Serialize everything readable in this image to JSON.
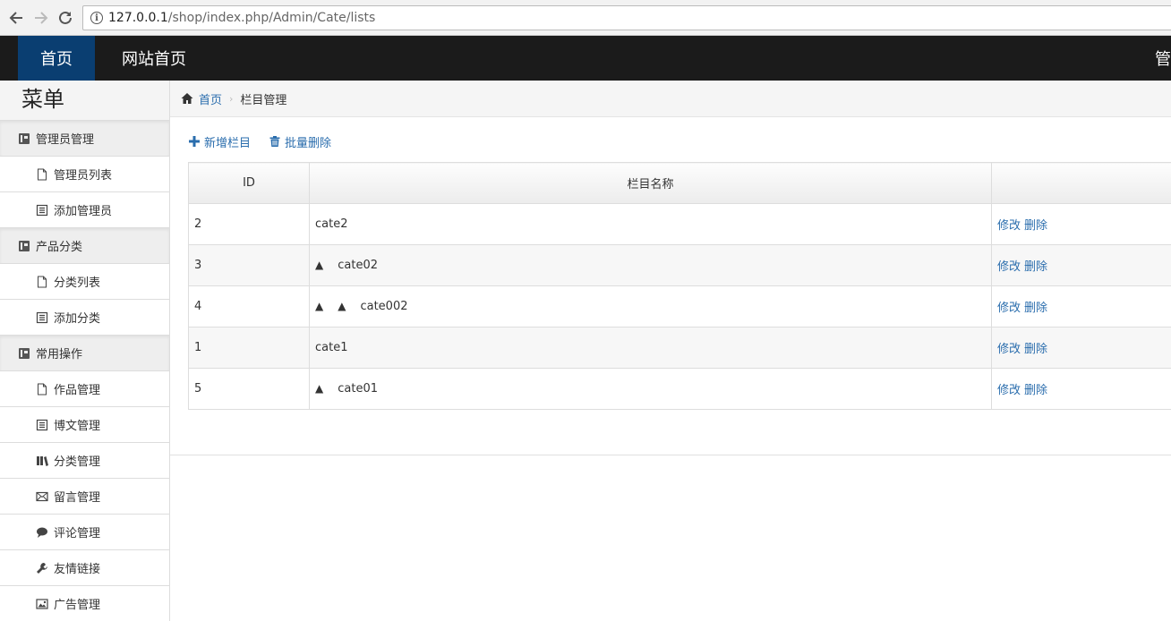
{
  "browser": {
    "url_host": "127.0.0.1",
    "url_path": "/shop/index.php/Admin/Cate/lists"
  },
  "topnav": {
    "home": "首页",
    "site_home": "网站首页",
    "right_partial": "管"
  },
  "sidebar": {
    "title": "菜单",
    "groups": [
      {
        "label": "管理员管理",
        "items": [
          {
            "label": "管理员列表",
            "icon": "file-icon"
          },
          {
            "label": "添加管理员",
            "icon": "list-icon"
          }
        ]
      },
      {
        "label": "产品分类",
        "items": [
          {
            "label": "分类列表",
            "icon": "file-icon"
          },
          {
            "label": "添加分类",
            "icon": "list-icon"
          }
        ]
      },
      {
        "label": "常用操作",
        "items": [
          {
            "label": "作品管理",
            "icon": "file-icon"
          },
          {
            "label": "博文管理",
            "icon": "list-icon"
          },
          {
            "label": "分类管理",
            "icon": "books-icon"
          },
          {
            "label": "留言管理",
            "icon": "envelope-icon"
          },
          {
            "label": "评论管理",
            "icon": "comment-icon"
          },
          {
            "label": "友情链接",
            "icon": "wrench-icon"
          },
          {
            "label": "广告管理",
            "icon": "picture-icon"
          }
        ]
      }
    ]
  },
  "breadcrumb": {
    "home": "首页",
    "current": "栏目管理"
  },
  "toolbar": {
    "add": "新增栏目",
    "batch_delete": "批量删除"
  },
  "table": {
    "headers": [
      "ID",
      "栏目名称",
      ""
    ],
    "rows": [
      {
        "id": "2",
        "level": 0,
        "name": "cate2"
      },
      {
        "id": "3",
        "level": 1,
        "name": "cate02"
      },
      {
        "id": "4",
        "level": 2,
        "name": "cate002"
      },
      {
        "id": "1",
        "level": 0,
        "name": "cate1"
      },
      {
        "id": "5",
        "level": 1,
        "name": "cate01"
      }
    ],
    "marker": "▲",
    "edit": "修改",
    "delete": "删除"
  },
  "colors": {
    "link": "#2a6dad",
    "topnav_bg": "#1b1b1b",
    "active_tab": "#0a3e71"
  }
}
